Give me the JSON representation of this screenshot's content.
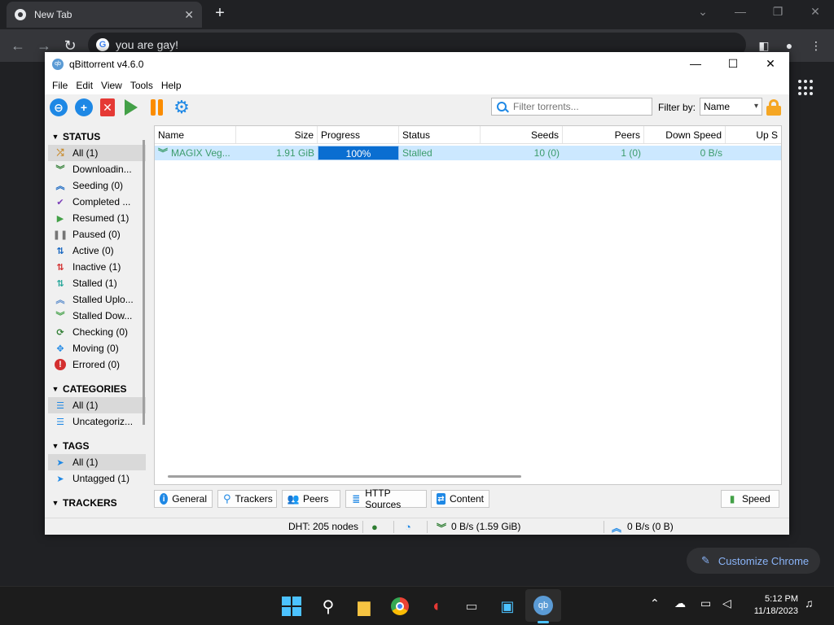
{
  "browser": {
    "tab_title": "New Tab",
    "tab_close": "✕",
    "new_tab": "+",
    "address_text": "you are gay!",
    "customize_label": "Customize Chrome"
  },
  "qb": {
    "title": "qBittorrent v4.6.0",
    "menu": [
      "File",
      "Edit",
      "View",
      "Tools",
      "Help"
    ],
    "search_placeholder": "Filter torrents...",
    "filter_by_label": "Filter by:",
    "filter_by_value": "Name",
    "sidebar": {
      "status_header": "STATUS",
      "status_items": [
        {
          "label": "All (1)",
          "icon": "shuffle-icon",
          "color": "#c88a2a"
        },
        {
          "label": "Downloadin...",
          "icon": "double-chevron-down-icon",
          "color": "#2e7d32"
        },
        {
          "label": "Seeding (0)",
          "icon": "double-chevron-up-icon",
          "color": "#1565c0"
        },
        {
          "label": "Completed ...",
          "icon": "check-icon",
          "color": "#7b3fb8"
        },
        {
          "label": "Resumed (1)",
          "icon": "play-icon",
          "color": "#43a047"
        },
        {
          "label": "Paused (0)",
          "icon": "pause-icon",
          "color": "#757575"
        },
        {
          "label": "Active (0)",
          "icon": "up-down-arrows-icon",
          "color": "#1565c0"
        },
        {
          "label": "Inactive (1)",
          "icon": "up-down-arrows-red-icon",
          "color": "#d32f2f"
        },
        {
          "label": "Stalled (1)",
          "icon": "up-down-arrows-stalled-icon",
          "color": "#26a69a"
        },
        {
          "label": "Stalled Uplo...",
          "icon": "stalled-upload-icon",
          "color": "#5c8dcc"
        },
        {
          "label": "Stalled Dow...",
          "icon": "stalled-download-icon",
          "color": "#43a047"
        },
        {
          "label": "Checking (0)",
          "icon": "refresh-icon",
          "color": "#2e7d32"
        },
        {
          "label": "Moving (0)",
          "icon": "move-icon",
          "color": "#1e88e5"
        },
        {
          "label": "Errored (0)",
          "icon": "error-icon",
          "color": "#d32f2f"
        }
      ],
      "categories_header": "CATEGORIES",
      "category_items": [
        {
          "label": "All (1)",
          "icon": "list-icon",
          "color": "#1e88e5"
        },
        {
          "label": "Uncategoriz...",
          "icon": "list-icon",
          "color": "#1e88e5"
        }
      ],
      "tags_header": "TAGS",
      "tag_items": [
        {
          "label": "All (1)",
          "icon": "tag-icon",
          "color": "#1e88e5"
        },
        {
          "label": "Untagged (1)",
          "icon": "tag-icon",
          "color": "#1e88e5"
        }
      ],
      "trackers_header": "TRACKERS"
    },
    "columns": [
      "Name",
      "Size",
      "Progress",
      "Status",
      "Seeds",
      "Peers",
      "Down Speed",
      "Up S"
    ],
    "rows": [
      {
        "name": "MAGIX Veg...",
        "size": "1.91 GiB",
        "progress": "100%",
        "progress_fraction": 1.0,
        "status": "Stalled",
        "seeds": "10 (0)",
        "peers": "1 (0)",
        "down_speed": "0 B/s"
      }
    ],
    "bottom_tabs": [
      "General",
      "Trackers",
      "Peers",
      "HTTP Sources",
      "Content"
    ],
    "speed_tab": "Speed",
    "status_bar": {
      "dht": "DHT: 205 nodes",
      "download": "0 B/s (1.59 GiB)",
      "upload": "0 B/s (0 B)"
    }
  },
  "taskbar": {
    "time": "5:12 PM",
    "date": "11/18/2023"
  }
}
